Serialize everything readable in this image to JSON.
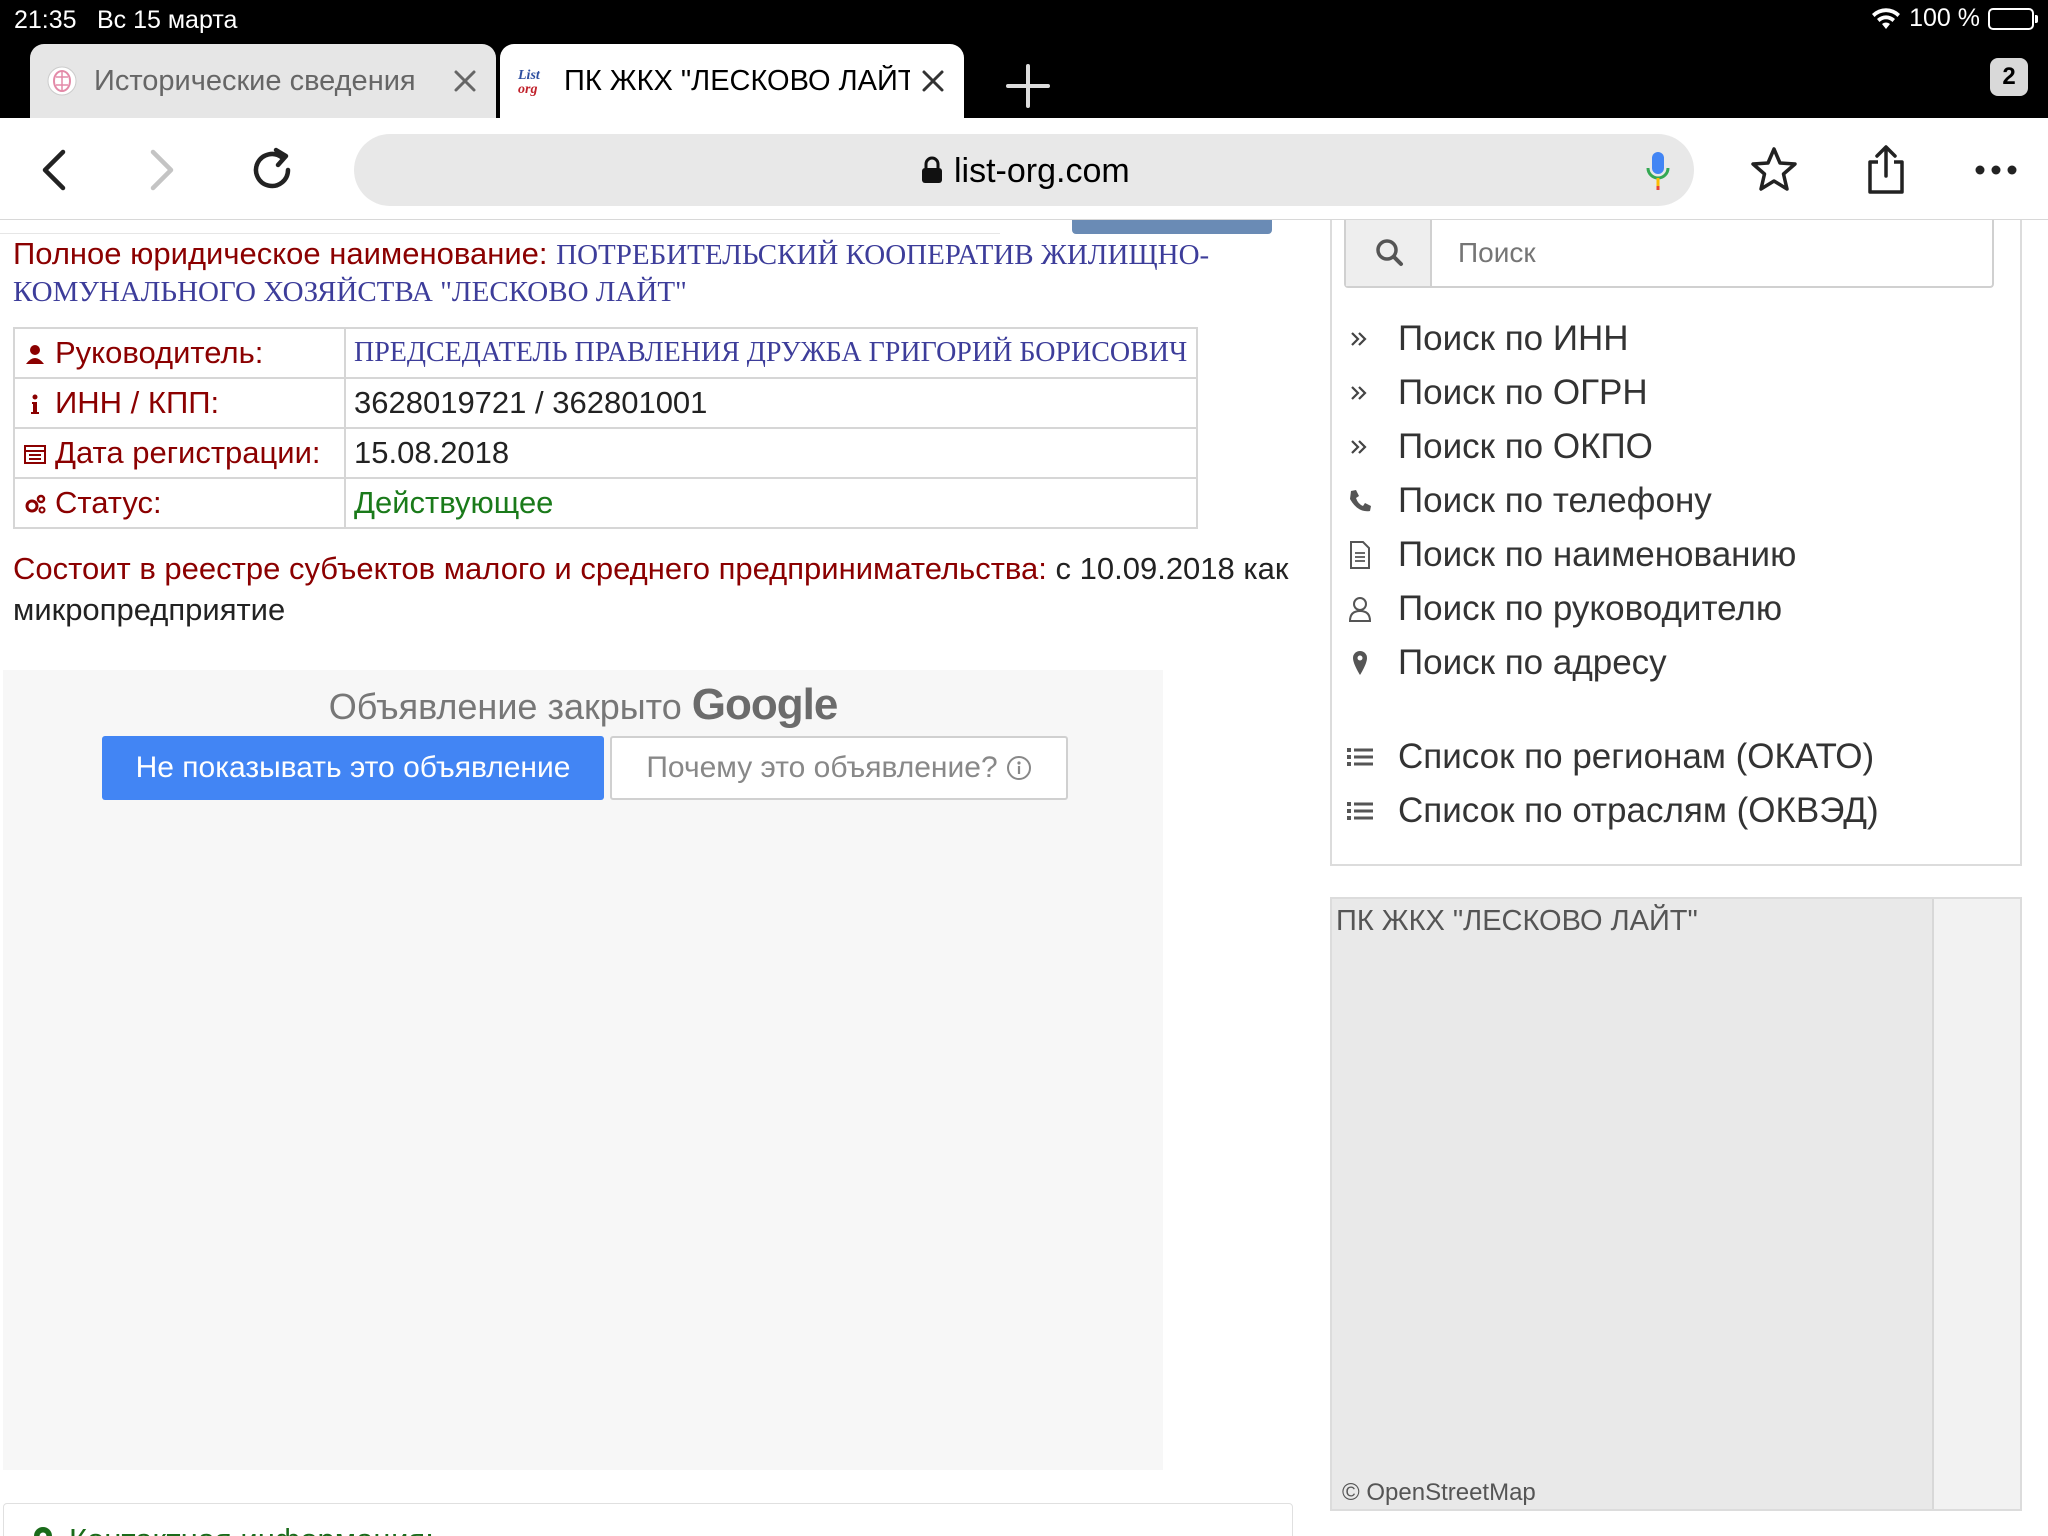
{
  "status_bar": {
    "time": "21:35",
    "date": "Вс 15 марта",
    "battery": "100 %"
  },
  "tabs": [
    {
      "title": "Исторические сведения",
      "active": false,
      "favicon": "brain-logo-icon"
    },
    {
      "title": "ПК ЖКХ \"ЛЕСКОВО ЛАЙТ\"",
      "active": true,
      "favicon": "list-org-logo-icon"
    }
  ],
  "tab_count": "2",
  "address_bar": {
    "url": "list-org.com"
  },
  "company": {
    "fullname_label": "Полное юридическое наименование:",
    "fullname_value": "ПОТРЕБИТЕЛЬСКИЙ КООПЕРАТИВ ЖИЛИЩНО-КОМУНАЛЬНОГО ХОЗЯЙСТВА \"ЛЕСКОВО ЛАЙТ\"",
    "rows": [
      {
        "icon": "user-icon",
        "label": "Руководитель:",
        "value": "ПРЕДСЕДАТЕЛЬ ПРАВЛЕНИЯ ДРУЖБА ГРИГОРИЙ БОРИСОВИЧ"
      },
      {
        "icon": "info-icon",
        "label": "ИНН / КПП:",
        "value": "3628019721 / 362801001"
      },
      {
        "icon": "calendar-icon",
        "label": "Дата регистрации:",
        "value": "15.08.2018"
      },
      {
        "icon": "gears-icon",
        "label": "Статус:",
        "value": "Действующее"
      }
    ],
    "msp_label": "Состоит в реестре субъектов малого и среднего предпринимательства:",
    "msp_value": "с 10.09.2018 как микропредприятие"
  },
  "ad": {
    "closed_text": "Объявление закрыто",
    "brand": "Google",
    "hide_button": "Не показывать это объявление",
    "why_button": "Почему это объявление?"
  },
  "contact_heading": "Контактная информация:",
  "sidebar": {
    "search_placeholder": "Поиск",
    "links": [
      {
        "icon": "double-chevron-icon",
        "label": "Поиск по ИНН"
      },
      {
        "icon": "double-chevron-icon",
        "label": "Поиск по ОГРН"
      },
      {
        "icon": "double-chevron-icon",
        "label": "Поиск по ОКПО"
      },
      {
        "icon": "phone-icon",
        "label": "Поиск по телефону"
      },
      {
        "icon": "document-icon",
        "label": "Поиск по наименованию"
      },
      {
        "icon": "person-outline-icon",
        "label": "Поиск по руководителю"
      },
      {
        "icon": "map-pin-icon",
        "label": "Поиск по адресу"
      }
    ],
    "list_links": [
      {
        "icon": "list-icon",
        "label": "Список по регионам (ОКАТО)"
      },
      {
        "icon": "list-icon",
        "label": "Список по отраслям (ОКВЭД)"
      }
    ]
  },
  "map": {
    "title": "ПК ЖКХ \"ЛЕСКОВО ЛАЙТ\"",
    "attribution": "© OpenStreetMap"
  },
  "colors": {
    "label_red": "#8b0000",
    "value_blue": "#3d3d9a",
    "status_green": "#1a7a1a",
    "google_blue": "#4285f4"
  }
}
